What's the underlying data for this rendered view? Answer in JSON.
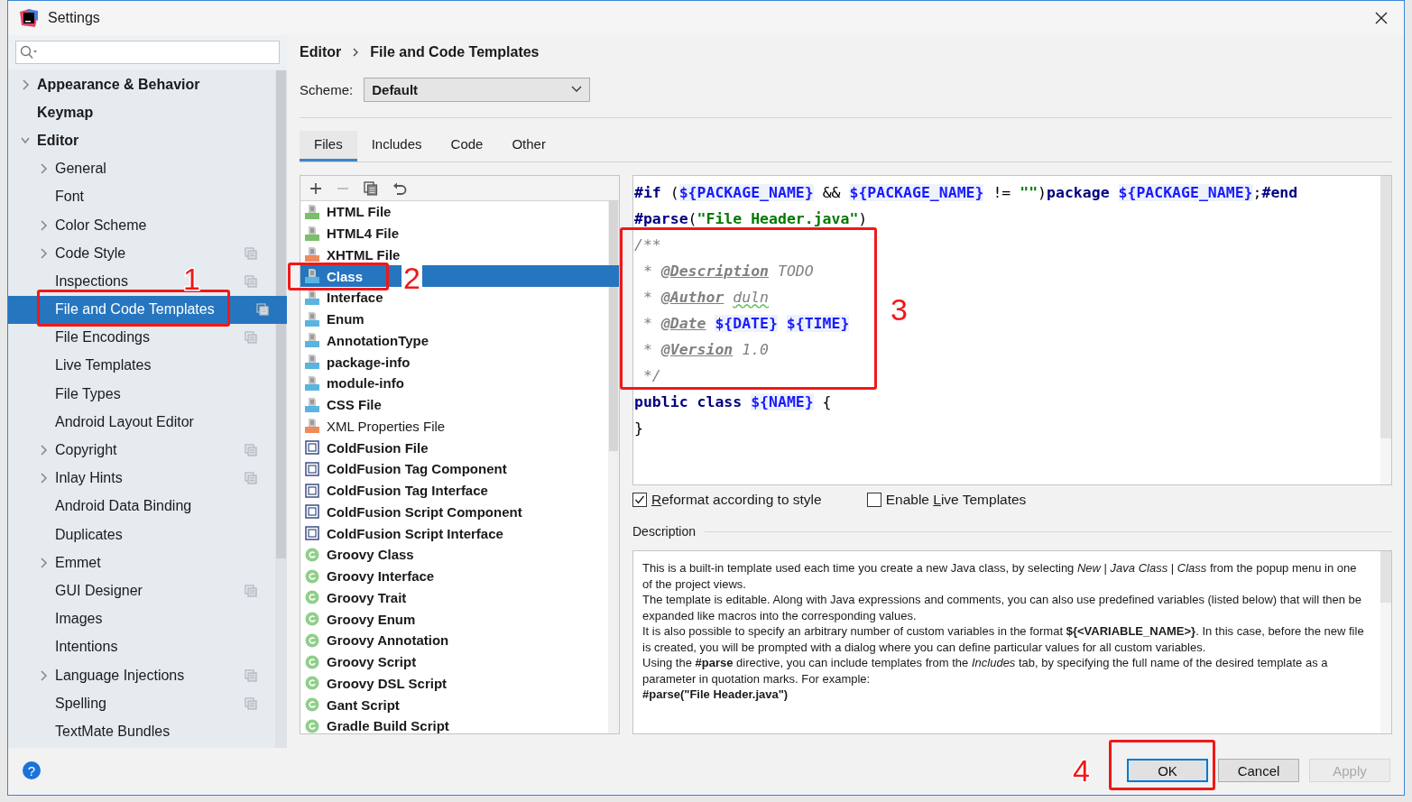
{
  "window": {
    "title": "Settings"
  },
  "sidebar": {
    "items": [
      {
        "label": "Appearance & Behavior",
        "kind": "group",
        "expanded": false,
        "selected": false,
        "shared": false
      },
      {
        "label": "Keymap",
        "kind": "leaf",
        "selected": false,
        "shared": false
      },
      {
        "label": "Editor",
        "kind": "group",
        "expanded": true,
        "selected": false,
        "shared": false,
        "children": [
          {
            "label": "General",
            "kind": "group",
            "expanded": false,
            "selected": false,
            "shared": false
          },
          {
            "label": "Font",
            "kind": "leaf",
            "selected": false,
            "shared": false
          },
          {
            "label": "Color Scheme",
            "kind": "group",
            "expanded": false,
            "selected": false,
            "shared": false
          },
          {
            "label": "Code Style",
            "kind": "group",
            "expanded": false,
            "selected": false,
            "shared": true
          },
          {
            "label": "Inspections",
            "kind": "leaf",
            "selected": false,
            "shared": true
          },
          {
            "label": "File and Code Templates",
            "kind": "leaf",
            "selected": true,
            "shared": true,
            "annotation": "1"
          },
          {
            "label": "File Encodings",
            "kind": "leaf",
            "selected": false,
            "shared": true
          },
          {
            "label": "Live Templates",
            "kind": "leaf",
            "selected": false,
            "shared": false
          },
          {
            "label": "File Types",
            "kind": "leaf",
            "selected": false,
            "shared": false
          },
          {
            "label": "Android Layout Editor",
            "kind": "leaf",
            "selected": false,
            "shared": false
          },
          {
            "label": "Copyright",
            "kind": "group",
            "expanded": false,
            "selected": false,
            "shared": true
          },
          {
            "label": "Inlay Hints",
            "kind": "group",
            "expanded": false,
            "selected": false,
            "shared": true
          },
          {
            "label": "Android Data Binding",
            "kind": "leaf",
            "selected": false,
            "shared": false
          },
          {
            "label": "Duplicates",
            "kind": "leaf",
            "selected": false,
            "shared": false
          },
          {
            "label": "Emmet",
            "kind": "group",
            "expanded": false,
            "selected": false,
            "shared": false
          },
          {
            "label": "GUI Designer",
            "kind": "leaf",
            "selected": false,
            "shared": true
          },
          {
            "label": "Images",
            "kind": "leaf",
            "selected": false,
            "shared": false
          },
          {
            "label": "Intentions",
            "kind": "leaf",
            "selected": false,
            "shared": false
          },
          {
            "label": "Language Injections",
            "kind": "group",
            "expanded": false,
            "selected": false,
            "shared": true
          },
          {
            "label": "Spelling",
            "kind": "leaf",
            "selected": false,
            "shared": true
          },
          {
            "label": "TextMate Bundles",
            "kind": "leaf",
            "selected": false,
            "shared": false
          }
        ]
      }
    ]
  },
  "breadcrumb": [
    "Editor",
    "File and Code Templates"
  ],
  "scheme": {
    "label": "Scheme:",
    "value": "Default"
  },
  "tabs": [
    {
      "label": "Files",
      "selected": true
    },
    {
      "label": "Includes",
      "selected": false
    },
    {
      "label": "Code",
      "selected": false
    },
    {
      "label": "Other",
      "selected": false
    }
  ],
  "templates": [
    {
      "label": "HTML File",
      "kind": "html",
      "bold": true,
      "selected": false
    },
    {
      "label": "HTML4 File",
      "kind": "html",
      "bold": true,
      "selected": false
    },
    {
      "label": "XHTML File",
      "kind": "xhtml",
      "bold": true,
      "selected": false
    },
    {
      "label": "Class",
      "kind": "java",
      "bold": true,
      "selected": true,
      "annotation": "2"
    },
    {
      "label": "Interface",
      "kind": "java",
      "bold": true,
      "selected": false
    },
    {
      "label": "Enum",
      "kind": "java",
      "bold": true,
      "selected": false
    },
    {
      "label": "AnnotationType",
      "kind": "java",
      "bold": true,
      "selected": false
    },
    {
      "label": "package-info",
      "kind": "java",
      "bold": true,
      "selected": false
    },
    {
      "label": "module-info",
      "kind": "java",
      "bold": true,
      "selected": false
    },
    {
      "label": "CSS File",
      "kind": "css",
      "bold": true,
      "selected": false
    },
    {
      "label": "XML Properties File",
      "kind": "xml",
      "bold": false,
      "selected": false
    },
    {
      "label": "ColdFusion File",
      "kind": "cf",
      "bold": true,
      "selected": false
    },
    {
      "label": "ColdFusion Tag Component",
      "kind": "cf",
      "bold": true,
      "selected": false
    },
    {
      "label": "ColdFusion Tag Interface",
      "kind": "cf",
      "bold": true,
      "selected": false
    },
    {
      "label": "ColdFusion Script Component",
      "kind": "cf",
      "bold": true,
      "selected": false
    },
    {
      "label": "ColdFusion Script Interface",
      "kind": "cf",
      "bold": true,
      "selected": false
    },
    {
      "label": "Groovy Class",
      "kind": "groovy",
      "bold": true,
      "selected": false
    },
    {
      "label": "Groovy Interface",
      "kind": "groovy",
      "bold": true,
      "selected": false
    },
    {
      "label": "Groovy Trait",
      "kind": "groovy",
      "bold": true,
      "selected": false
    },
    {
      "label": "Groovy Enum",
      "kind": "groovy",
      "bold": true,
      "selected": false
    },
    {
      "label": "Groovy Annotation",
      "kind": "groovy",
      "bold": true,
      "selected": false
    },
    {
      "label": "Groovy Script",
      "kind": "groovy",
      "bold": true,
      "selected": false
    },
    {
      "label": "Groovy DSL Script",
      "kind": "groovy",
      "bold": true,
      "selected": false
    },
    {
      "label": "Gant Script",
      "kind": "groovy",
      "bold": true,
      "selected": false
    },
    {
      "label": "Gradle Build Script",
      "kind": "groovy",
      "bold": true,
      "selected": false
    }
  ],
  "code": {
    "blocks": [
      {
        "lines": [
          [
            {
              "text": "#if",
              "kind": "keyword"
            },
            {
              "text": " (",
              "kind": "plain"
            },
            {
              "text": "${PACKAGE_NAME}",
              "kind": "variable"
            },
            {
              "text": " && ",
              "kind": "plain"
            },
            {
              "text": "${PACKAGE_NAME}",
              "kind": "variable"
            },
            {
              "text": " != ",
              "kind": "plain"
            },
            {
              "text": "\"\"",
              "kind": "string"
            },
            {
              "text": ")",
              "kind": "plain"
            },
            {
              "text": "package ",
              "kind": "keyword"
            },
            {
              "text": "${PACKAGE_NAME}",
              "kind": "variable"
            },
            {
              "text": ";",
              "kind": "plain"
            },
            {
              "text": "#end",
              "kind": "keyword"
            }
          ],
          [
            {
              "text": "#parse",
              "kind": "keyword"
            },
            {
              "text": "(",
              "kind": "plain"
            },
            {
              "text": "\"File Header.java\"",
              "kind": "string"
            },
            {
              "text": ")",
              "kind": "plain"
            }
          ]
        ]
      },
      {
        "annotation": "3",
        "lines": [
          [
            {
              "text": "/**",
              "kind": "comment"
            }
          ],
          [
            {
              "text": " * ",
              "kind": "comment"
            },
            {
              "text": "@Description",
              "kind": "doctag"
            },
            {
              "text": " TODO",
              "kind": "comment"
            }
          ],
          [
            {
              "text": " * ",
              "kind": "comment"
            },
            {
              "text": "@Author",
              "kind": "doctag"
            },
            {
              "text": "duln",
              "kind": "typo",
              "gap": true
            }
          ],
          [
            {
              "text": " * ",
              "kind": "comment"
            },
            {
              "text": "@Date",
              "kind": "doctag"
            },
            {
              "text": "${DATE}",
              "kind": "variable",
              "gap": true
            },
            {
              "text": "${TIME}",
              "kind": "variable",
              "gap": true
            }
          ],
          [
            {
              "text": " * ",
              "kind": "comment"
            },
            {
              "text": "@Version",
              "kind": "doctag"
            },
            {
              "text": " 1.0",
              "kind": "comment"
            }
          ],
          [
            {
              "text": " */",
              "kind": "comment"
            }
          ]
        ]
      },
      {
        "lines": [
          [
            {
              "text": "public class ",
              "kind": "keyword"
            },
            {
              "text": "${NAME}",
              "kind": "variable"
            },
            {
              "text": " {",
              "kind": "plain"
            }
          ],
          [
            {
              "text": "}",
              "kind": "plain"
            }
          ]
        ]
      }
    ]
  },
  "options": [
    {
      "mnemonic": "R",
      "rest": "eformat according to style",
      "checked": true
    },
    {
      "prefix": "Enable ",
      "mnemonic": "L",
      "rest": "ive Templates",
      "checked": false
    }
  ],
  "description": {
    "label": "Description",
    "paragraphs": [
      {
        "kind": "text",
        "text": "This is a built-in template used each time you create a new Java class, by selecting *New* | *Java Class* | *Class* from the popup menu in one of the project views."
      },
      {
        "kind": "text",
        "text": "The template is editable. Along with Java expressions and comments, you can also use predefined variables (listed below) that will then be expanded like macros into the corresponding values."
      },
      {
        "kind": "text",
        "text": "It is also possible to specify an arbitrary number of custom variables in the format **${<VARIABLE_NAME>}**. In this case, before the new file is created, you will be prompted with a dialog where you can define particular values for all custom variables."
      },
      {
        "kind": "text",
        "text": "Using the **#parse** directive, you can include templates from the *Includes* tab, by specifying the full name of the desired template as a parameter in quotation marks. For example:"
      },
      {
        "kind": "code",
        "text": "#parse(\"File Header.java\")"
      }
    ]
  },
  "help": "?",
  "buttons": [
    {
      "label": "OK",
      "kind": "default",
      "disabled": false,
      "annotation": "4"
    },
    {
      "label": "Cancel",
      "kind": "normal",
      "disabled": false
    },
    {
      "label": "Apply",
      "kind": "normal",
      "disabled": true
    }
  ]
}
